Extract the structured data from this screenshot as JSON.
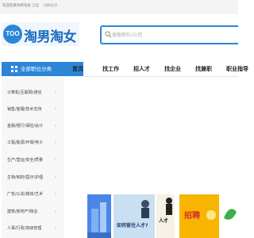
{
  "topbar": {
    "welcome": "欢迎您来淘男淘女",
    "links": [
      "全国",
      "切换站点"
    ]
  },
  "logo": {
    "badge": "TOO",
    "text": "淘男淘女"
  },
  "search": {
    "placeholder": "搜索职位/公司"
  },
  "nav": {
    "all_categories": "全部职位分类",
    "items": [
      "首页",
      "找工作",
      "招人才",
      "找企业",
      "找兼职",
      "职业指导"
    ]
  },
  "sidebar": {
    "categories": [
      "计算机/互联网/通信",
      "销售/客服/技术支持",
      "金融/银行/保险/会计",
      "工程/能源/环保/电子",
      "生产/营运/安全/质量",
      "生物/制药/医疗/护理",
      "广告/公关/媒体/艺术",
      "建筑/房地产/物业",
      "人事/行政/高级管理"
    ]
  },
  "banners": {
    "b2_text": "如何留住人才?",
    "b3_text": "人才",
    "b4_text": "招聘",
    "b5_text": ""
  },
  "colors": {
    "accent": "#2b86d8",
    "sidebar_bg": "#f7f7f7"
  }
}
